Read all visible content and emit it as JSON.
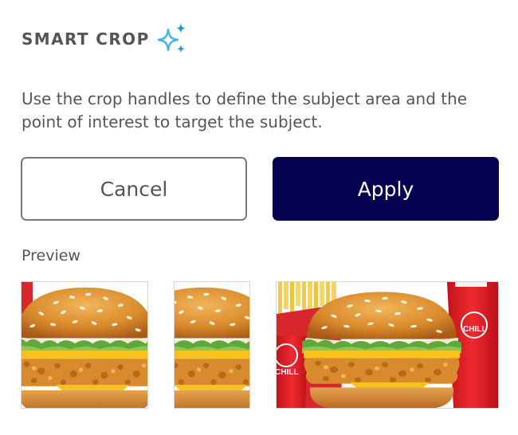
{
  "header": {
    "title": "SMART CROP",
    "icon": "sparkle-icon",
    "icon_colors": [
      "#3fb5e8",
      "#2196d8"
    ]
  },
  "description": "Use the crop handles to define the subject area and the point of interest to target the subject.",
  "actions": {
    "cancel_label": "Cancel",
    "apply_label": "Apply",
    "apply_color": "#05004f"
  },
  "preview": {
    "label": "Preview",
    "thumbnails": [
      {
        "name": "preview-square",
        "alt": "Square crop preview of chicken burger"
      },
      {
        "name": "preview-portrait",
        "alt": "Portrait crop preview of chicken burger"
      },
      {
        "name": "preview-landscape",
        "alt": "Landscape crop preview of chicken burger meal with fries and drink",
        "cup_text": "CHILL"
      }
    ]
  }
}
